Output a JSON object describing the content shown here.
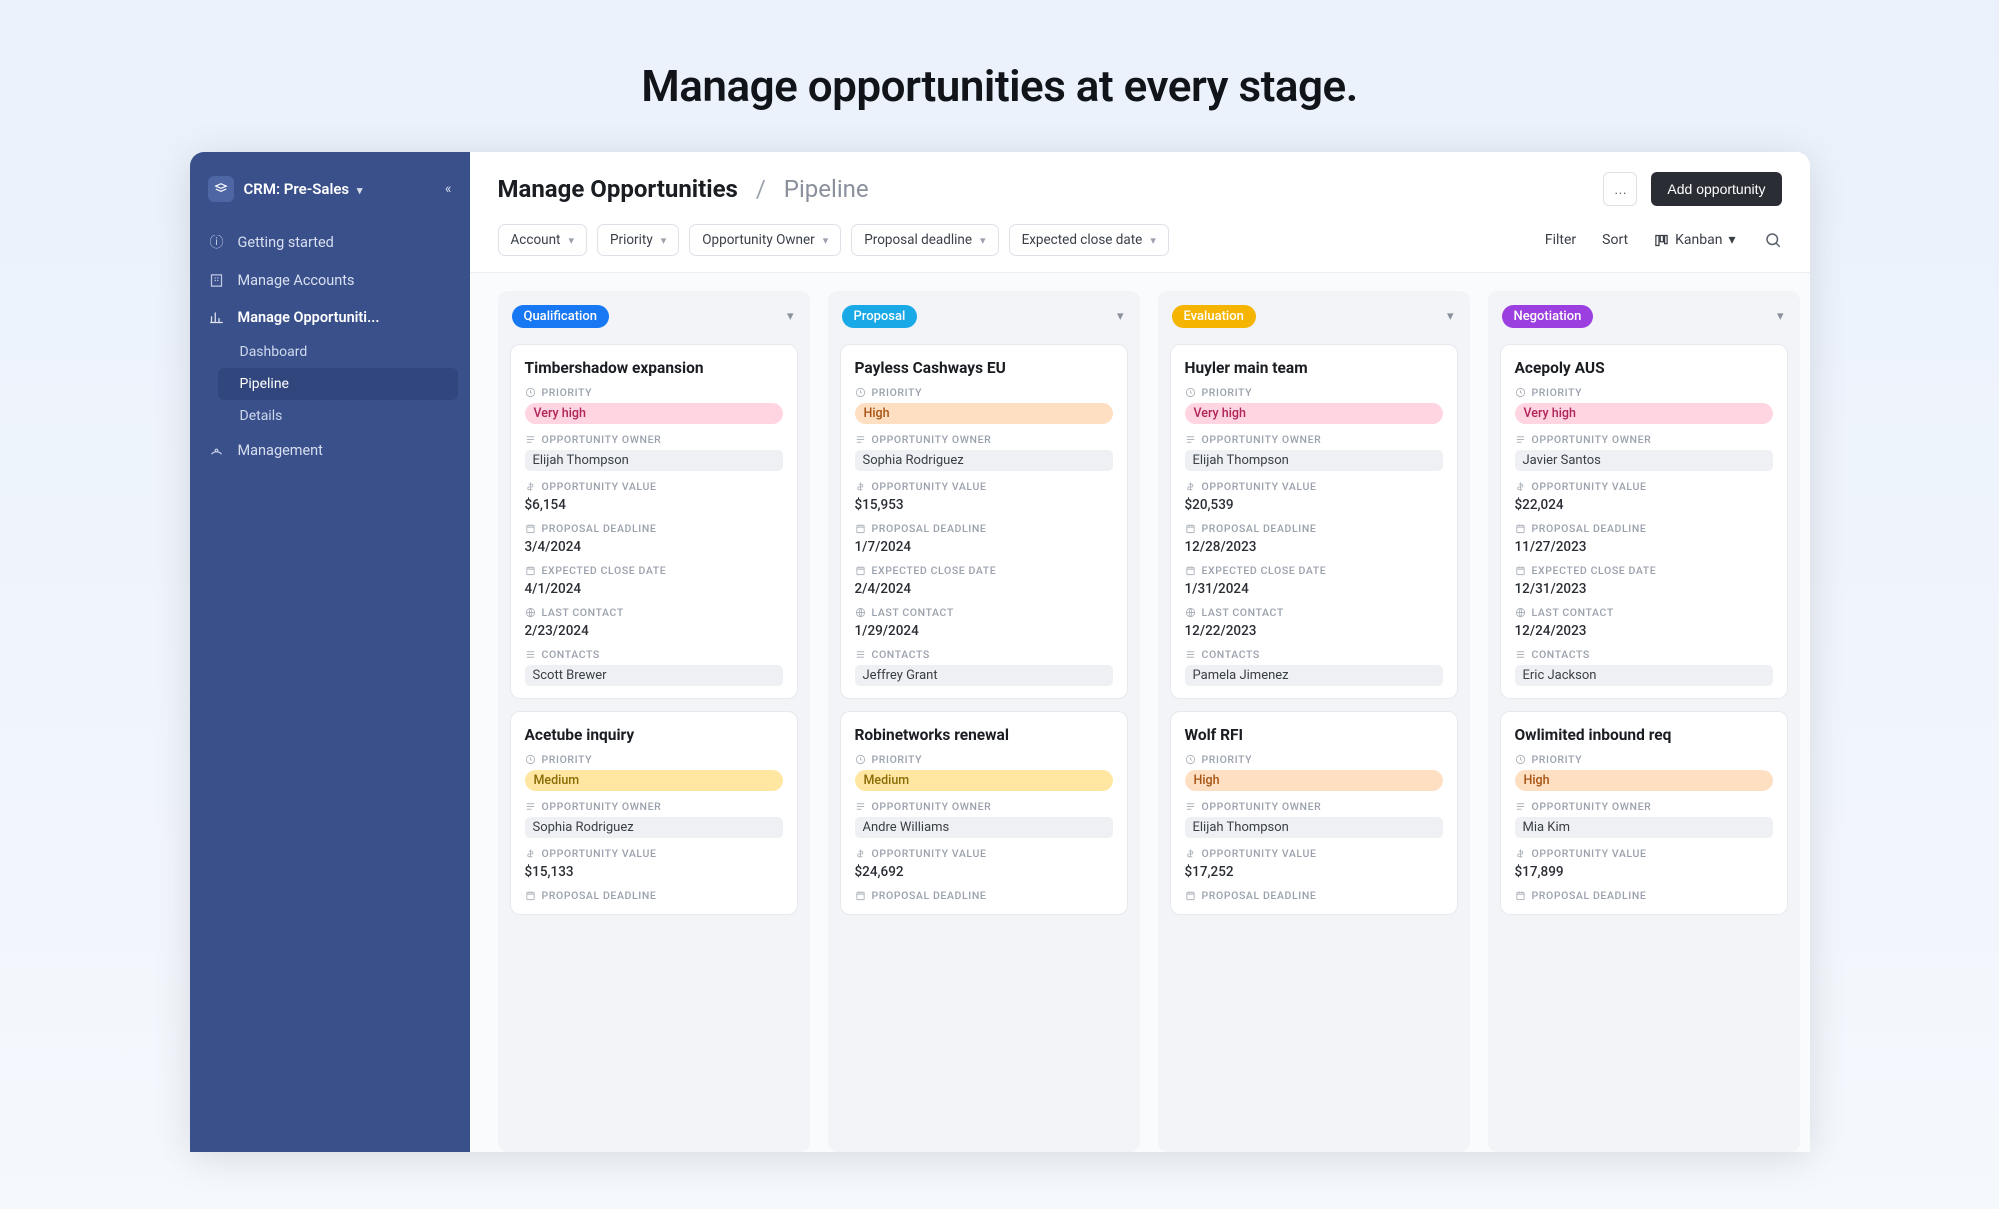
{
  "hero": "Manage opportunities at every stage.",
  "sidebar": {
    "title": "CRM: Pre-Sales",
    "items": [
      {
        "label": "Getting started"
      },
      {
        "label": "Manage Accounts"
      },
      {
        "label": "Manage Opportuniti..."
      },
      {
        "label": "Management"
      }
    ],
    "sub": [
      {
        "label": "Dashboard"
      },
      {
        "label": "Pipeline"
      },
      {
        "label": "Details"
      }
    ]
  },
  "header": {
    "title": "Manage Opportunities",
    "sep": "/",
    "sub": "Pipeline",
    "ellipsis": "…",
    "add": "Add opportunity"
  },
  "toolbar": {
    "filters": [
      "Account",
      "Priority",
      "Opportunity Owner",
      "Proposal deadline",
      "Expected close date"
    ],
    "filter": "Filter",
    "sort": "Sort",
    "viewmode": "Kanban"
  },
  "labels": {
    "priority": "PRIORITY",
    "owner": "OPPORTUNITY OWNER",
    "value": "OPPORTUNITY VALUE",
    "deadline": "PROPOSAL DEADLINE",
    "close": "EXPECTED CLOSE DATE",
    "last": "LAST CONTACT",
    "contacts": "CONTACTS"
  },
  "priorityColors": {
    "Very high": {
      "bg": "#ffd5e1",
      "fg": "#b0245a"
    },
    "High": {
      "bg": "#ffdfc2",
      "fg": "#a65414"
    },
    "Medium": {
      "bg": "#ffe7a1",
      "fg": "#8a6b06"
    }
  },
  "columns": [
    {
      "stage": "Qualification",
      "color": "#1877f2",
      "cards": [
        {
          "title": "Timbershadow expansion",
          "priority": "Very high",
          "owner": "Elijah Thompson",
          "value": "$6,154",
          "deadline": "3/4/2024",
          "close": "4/1/2024",
          "last": "2/23/2024",
          "contacts": "Scott Brewer"
        },
        {
          "title": "Acetube inquiry",
          "priority": "Medium",
          "owner": "Sophia Rodriguez",
          "value": "$15,133",
          "deadline": "",
          "close": "",
          "last": "",
          "contacts": ""
        }
      ]
    },
    {
      "stage": "Proposal",
      "color": "#18a9e6",
      "cards": [
        {
          "title": "Payless Cashways EU",
          "priority": "High",
          "owner": "Sophia Rodriguez",
          "value": "$15,953",
          "deadline": "1/7/2024",
          "close": "2/4/2024",
          "last": "1/29/2024",
          "contacts": "Jeffrey Grant"
        },
        {
          "title": "Robinetworks renewal",
          "priority": "Medium",
          "owner": "Andre Williams",
          "value": "$24,692",
          "deadline": "",
          "close": "",
          "last": "",
          "contacts": ""
        }
      ]
    },
    {
      "stage": "Evaluation",
      "color": "#f4b400",
      "cards": [
        {
          "title": "Huyler main team",
          "priority": "Very high",
          "owner": "Elijah Thompson",
          "value": "$20,539",
          "deadline": "12/28/2023",
          "close": "1/31/2024",
          "last": "12/22/2023",
          "contacts": "Pamela Jimenez"
        },
        {
          "title": "Wolf RFI",
          "priority": "High",
          "owner": "Elijah Thompson",
          "value": "$17,252",
          "deadline": "",
          "close": "",
          "last": "",
          "contacts": ""
        }
      ]
    },
    {
      "stage": "Negotiation",
      "color": "#9b3fe0",
      "cards": [
        {
          "title": "Acepoly AUS",
          "priority": "Very high",
          "owner": "Javier Santos",
          "value": "$22,024",
          "deadline": "11/27/2023",
          "close": "12/31/2023",
          "last": "12/24/2023",
          "contacts": "Eric Jackson"
        },
        {
          "title": "Owlimited inbound req",
          "priority": "High",
          "owner": "Mia Kim",
          "value": "$17,899",
          "deadline": "",
          "close": "",
          "last": "",
          "contacts": ""
        }
      ]
    }
  ]
}
